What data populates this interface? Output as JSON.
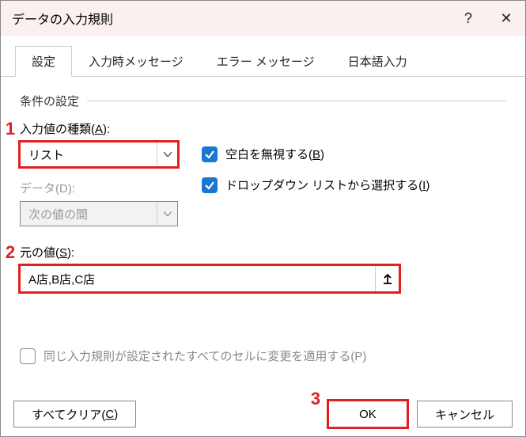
{
  "titlebar": {
    "title": "データの入力規則",
    "help": "?",
    "close": "✕"
  },
  "tabs": {
    "settings": "設定",
    "input_msg": "入力時メッセージ",
    "error_msg": "エラー メッセージ",
    "ime": "日本語入力"
  },
  "group": {
    "conditions": "条件の設定"
  },
  "markers": {
    "one": "1",
    "two": "2",
    "three": "3"
  },
  "allow": {
    "label_pre": "入力値の種類(",
    "label_key": "A",
    "label_post": "):",
    "value": "リスト"
  },
  "data_field": {
    "label": "データ(D):",
    "value": "次の値の間"
  },
  "ignore_blank": {
    "pre": "空白を無視する(",
    "key": "B",
    "post": ")"
  },
  "dropdown_opt": {
    "pre": "ドロップダウン リストから選択する(",
    "key": "I",
    "post": ")"
  },
  "source": {
    "label_pre": "元の値(",
    "label_key": "S",
    "label_post": "):",
    "value": "A店,B店,C店"
  },
  "apply_all": {
    "label": "同じ入力規則が設定されたすべてのセルに変更を適用する(P)"
  },
  "buttons": {
    "clear_pre": "すべてクリア(",
    "clear_key": "C",
    "clear_post": ")",
    "ok": "OK",
    "cancel": "キャンセル"
  }
}
